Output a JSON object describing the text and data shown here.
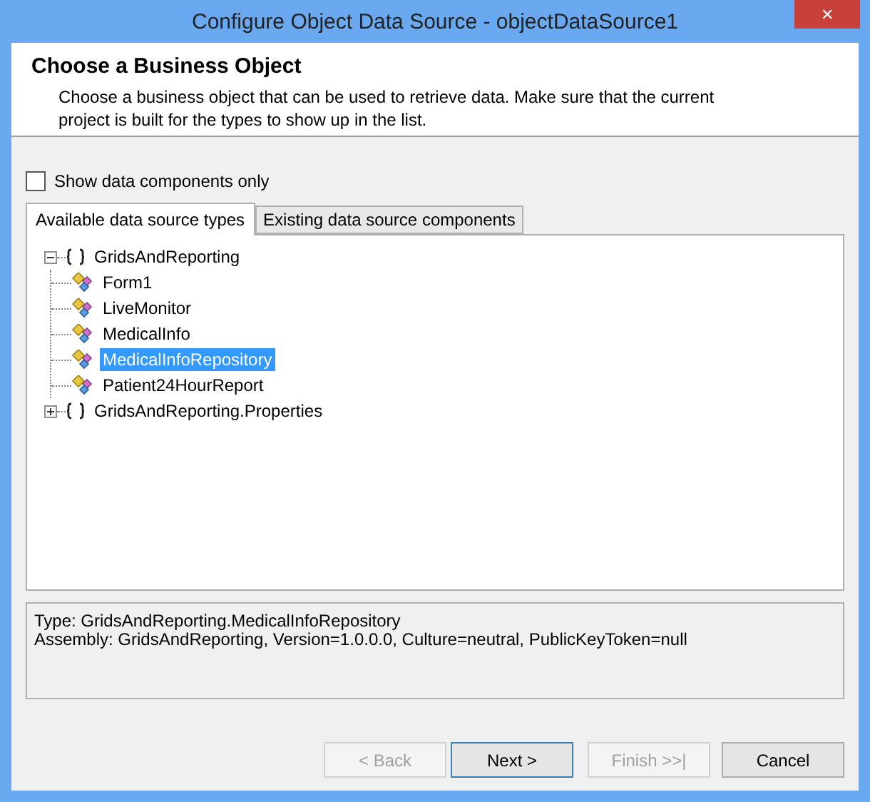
{
  "window": {
    "title": "Configure Object Data Source - objectDataSource1",
    "close": "✕"
  },
  "header": {
    "title": "Choose a Business Object",
    "description": "Choose a business object that can be used to retrieve data. Make sure that the current project is built for the types to show up in the list."
  },
  "show_data_components_only": {
    "label": "Show data components only",
    "checked": false
  },
  "tabs": [
    {
      "label": "Available data source types",
      "selected": true
    },
    {
      "label": "Existing data source components",
      "selected": false
    }
  ],
  "tree": [
    {
      "label": "GridsAndReporting",
      "kind": "namespace",
      "expanded": true,
      "selected": false,
      "children": [
        {
          "label": "Form1",
          "kind": "class",
          "selected": false
        },
        {
          "label": "LiveMonitor",
          "kind": "class",
          "selected": false
        },
        {
          "label": "MedicalInfo",
          "kind": "class",
          "selected": false
        },
        {
          "label": "MedicalInfoRepository",
          "kind": "class",
          "selected": true
        },
        {
          "label": "Patient24HourReport",
          "kind": "class",
          "selected": false
        }
      ]
    },
    {
      "label": "GridsAndReporting.Properties",
      "kind": "namespace",
      "expanded": false,
      "selected": false
    }
  ],
  "info": [
    "Type: GridsAndReporting.MedicalInfoRepository",
    "Assembly: GridsAndReporting, Version=1.0.0.0, Culture=neutral, PublicKeyToken=null"
  ],
  "buttons": [
    {
      "label": "< Back",
      "disabled": true,
      "default": false
    },
    {
      "label": "Next >",
      "disabled": false,
      "default": true
    },
    {
      "label": "Finish >>|",
      "disabled": true,
      "default": false
    },
    {
      "label": "Cancel",
      "disabled": false,
      "default": false
    }
  ]
}
